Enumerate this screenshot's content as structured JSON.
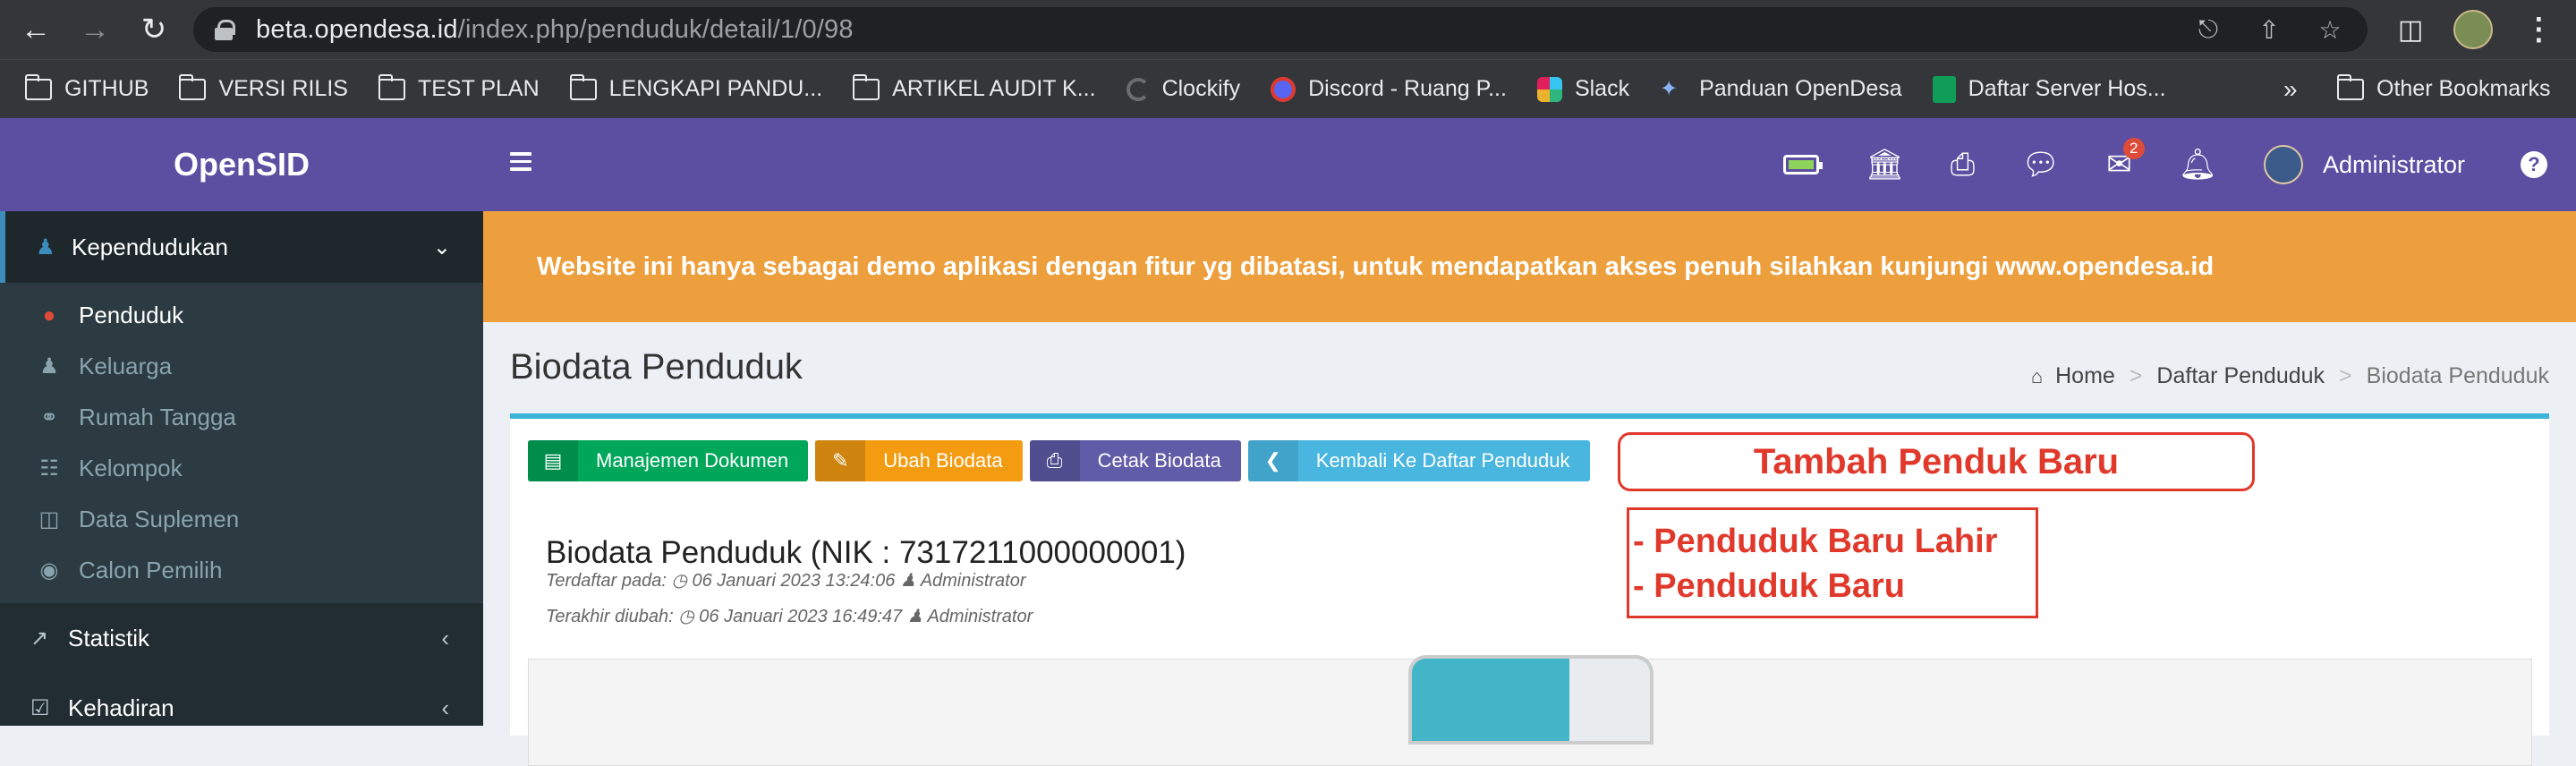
{
  "browser": {
    "url_host": "beta.opendesa.id",
    "url_path": "/index.php/penduduk/detail/1/0/98",
    "bookmarks": [
      {
        "label": "GITHUB",
        "icon": "folder-icon"
      },
      {
        "label": "VERSI RILIS",
        "icon": "folder-icon"
      },
      {
        "label": "TEST PLAN",
        "icon": "folder-icon"
      },
      {
        "label": "LENGKAPI PANDU...",
        "icon": "folder-icon"
      },
      {
        "label": "ARTIKEL AUDIT K...",
        "icon": "folder-icon"
      },
      {
        "label": "Clockify",
        "icon": "clockify-icon"
      },
      {
        "label": "Discord - Ruang P...",
        "icon": "discord-icon"
      },
      {
        "label": "Slack",
        "icon": "slack-icon"
      },
      {
        "label": "Panduan OpenDesa",
        "icon": "opendesa-icon"
      },
      {
        "label": "Daftar Server Hos...",
        "icon": "sheets-icon"
      }
    ],
    "more": "»",
    "other_bookmarks": "Other Bookmarks"
  },
  "app": {
    "logo": "OpenSID",
    "sidebar": {
      "section": "Kependudukan",
      "items": [
        {
          "label": "Penduduk",
          "icon": "user-icon",
          "active": true
        },
        {
          "label": "Keluarga",
          "icon": "users-icon"
        },
        {
          "label": "Rumah Tangga",
          "icon": "couple-icon"
        },
        {
          "label": "Kelompok",
          "icon": "sitemap-icon"
        },
        {
          "label": "Data Suplemen",
          "icon": "archive-icon"
        },
        {
          "label": "Calon Pemilih",
          "icon": "fingerprint-icon"
        }
      ],
      "menus": [
        {
          "label": "Statistik",
          "icon": "chart-icon"
        },
        {
          "label": "Kehadiran",
          "icon": "calendar-check-icon"
        }
      ]
    },
    "topbar": {
      "mail_badge": "2",
      "user": "Administrator"
    },
    "banner": "Website ini hanya sebagai demo aplikasi dengan fitur yg dibatasi, untuk mendapatkan akses penuh silahkan kunjungi www.opendesa.id",
    "page_title": "Biodata Penduduk",
    "breadcrumb": [
      "Home",
      "Daftar Penduduk",
      "Biodata Penduduk"
    ],
    "buttons": {
      "dokumen": "Manajemen Dokumen",
      "ubah": "Ubah Biodata",
      "cetak": "Cetak Biodata",
      "kembali": "Kembali Ke Daftar Penduduk"
    },
    "biodata": {
      "title": "Biodata Penduduk (NIK : 7317211000000001)",
      "registered": "Terdaftar pada:",
      "registered_date": "06 Januari 2023 13:24:06",
      "registered_by": "Administrator",
      "modified": "Terakhir diubah:",
      "modified_date": "06 Januari 2023 16:49:47",
      "modified_by": "Administrator"
    },
    "annotations": {
      "main": "Tambah Penduk Baru",
      "line1": "- Penduduk Baru Lahir",
      "line2": "- Penduduk Baru"
    }
  },
  "colors": {
    "header": "#5c4fa2",
    "banner": "#ec9f3c",
    "annotation": "#e0392b"
  }
}
